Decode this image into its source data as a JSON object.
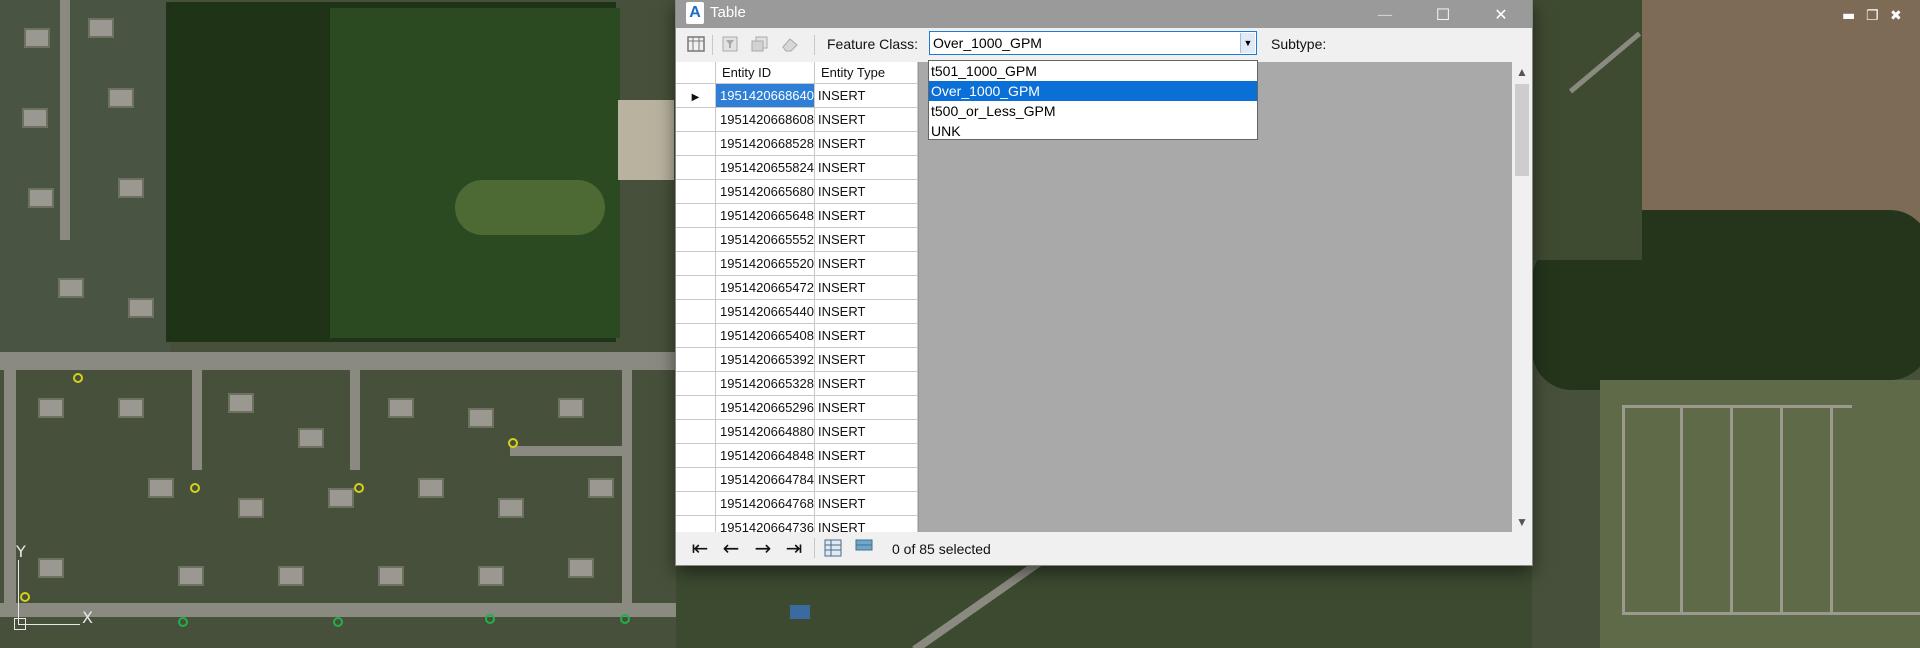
{
  "window": {
    "title": "Table",
    "app_icon": "A",
    "minimize_icon": "—",
    "maximize_icon": "☐",
    "close_icon": "✕"
  },
  "toolbar": {
    "feature_class_label": "Feature Class:",
    "feature_class_value": "Over_1000_GPM",
    "subtype_label": "Subtype:"
  },
  "dropdown": {
    "options": [
      "t501_1000_GPM",
      "Over_1000_GPM",
      "t500_or_Less_GPM",
      "UNK"
    ],
    "selected": "Over_1000_GPM"
  },
  "grid": {
    "columns": [
      "Entity ID",
      "Entity Type"
    ],
    "current_row_marker": "▶",
    "rows": [
      [
        "1951420668640",
        "INSERT"
      ],
      [
        "1951420668608",
        "INSERT"
      ],
      [
        "1951420668528",
        "INSERT"
      ],
      [
        "1951420655824",
        "INSERT"
      ],
      [
        "1951420665680",
        "INSERT"
      ],
      [
        "1951420665648",
        "INSERT"
      ],
      [
        "1951420665552",
        "INSERT"
      ],
      [
        "1951420665520",
        "INSERT"
      ],
      [
        "1951420665472",
        "INSERT"
      ],
      [
        "1951420665440",
        "INSERT"
      ],
      [
        "1951420665408",
        "INSERT"
      ],
      [
        "1951420665392",
        "INSERT"
      ],
      [
        "1951420665328",
        "INSERT"
      ],
      [
        "1951420665296",
        "INSERT"
      ],
      [
        "1951420664880",
        "INSERT"
      ],
      [
        "1951420664848",
        "INSERT"
      ],
      [
        "1951420664784",
        "INSERT"
      ],
      [
        "1951420664768",
        "INSERT"
      ],
      [
        "1951420664736",
        "INSERT"
      ]
    ]
  },
  "navigation": {
    "first_icon": "⇤",
    "prev_icon": "←",
    "next_icon": "→",
    "last_icon": "⇥",
    "status": "0 of 85 selected"
  },
  "ucs": {
    "y_label": "Y",
    "x_label": "X"
  },
  "colors": {
    "title_bar": "#9a9a9a",
    "selection": "#0a6fd6",
    "selected_cell": "#2f7fd6",
    "combo_border": "#1c7bd6"
  }
}
